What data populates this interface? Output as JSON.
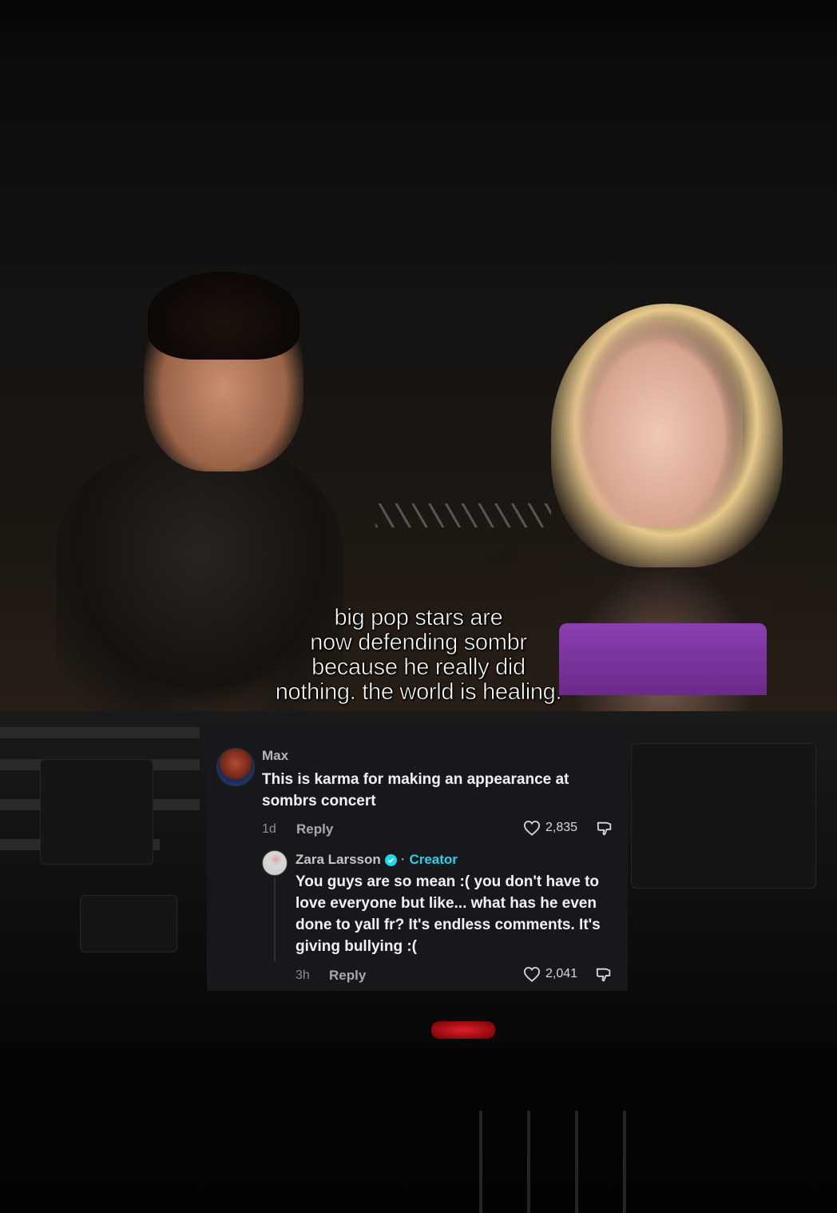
{
  "caption": {
    "lines": [
      "big pop stars are",
      "now defending sombr",
      "because he really did",
      "nothing. the world is healing."
    ]
  },
  "comment": {
    "author": "Max",
    "text": "This is karma for making an appearance at sombrs concert",
    "age": "1d",
    "reply_label": "Reply",
    "likes": "2,835",
    "avatar_icon": "user-avatar-photo"
  },
  "reply": {
    "author": "Zara Larsson",
    "separator": "·",
    "badge": "Creator",
    "text": "You guys are so mean :( you don't have to love everyone but like... what has he even done to yall fr? It's endless comments. It's giving bullying :(",
    "age": "3h",
    "reply_label": "Reply",
    "likes": "2,041",
    "verified_color": "#20d5ec"
  },
  "colors": {
    "card_bg": "#17181b",
    "creator_accent": "#2ad1ef"
  }
}
